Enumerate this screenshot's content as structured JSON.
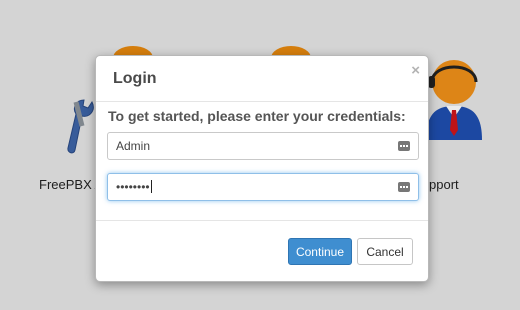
{
  "background": {
    "tiles": [
      {
        "label": "FreePBX Ac"
      },
      {
        "label": "pport"
      }
    ]
  },
  "modal": {
    "title": "Login",
    "close_glyph": "×",
    "prompt": "To get started, please enter your credentials:",
    "username": {
      "value": "Admin",
      "icon": "keyboard-icon"
    },
    "password": {
      "masked_value": "••••••••",
      "icon": "keyboard-icon"
    },
    "continue_label": "Continue",
    "cancel_label": "Cancel"
  },
  "colors": {
    "primary_button": "#3f8ed0",
    "focus_ring": "#66afe9",
    "page_background": "#e6e6e6"
  }
}
